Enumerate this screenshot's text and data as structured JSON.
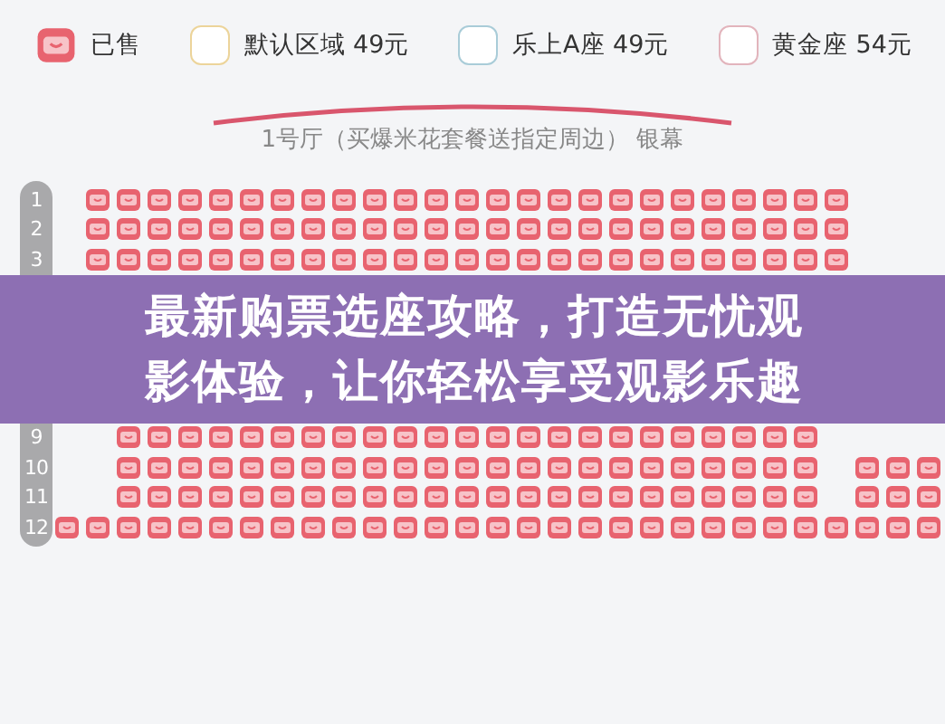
{
  "legend": [
    {
      "kind": "sold",
      "label": "已售"
    },
    {
      "kind": "default",
      "label": "默认区域 49元",
      "color": "#ecd49a"
    },
    {
      "kind": "zone",
      "label": "乐上A座 49元",
      "color": "#a9ccd8"
    },
    {
      "kind": "zone",
      "label": "黄金座 54元",
      "color": "#e2b4bc"
    }
  ],
  "screen": {
    "label": "1号厅（买爆米花套餐送指定周边） 银幕"
  },
  "rows_top": [
    {
      "number": "1",
      "seats": [
        {
          "kind": "gap"
        },
        {
          "kind": "seat",
          "sold": true
        },
        {
          "kind": "seat",
          "sold": true
        },
        {
          "kind": "seat",
          "sold": true
        },
        {
          "kind": "seat",
          "sold": true
        },
        {
          "kind": "seat",
          "sold": true
        },
        {
          "kind": "seat",
          "sold": true
        },
        {
          "kind": "seat",
          "sold": true
        },
        {
          "kind": "seat",
          "sold": true
        },
        {
          "kind": "seat",
          "sold": true
        },
        {
          "kind": "seat",
          "sold": true
        },
        {
          "kind": "seat",
          "sold": true
        },
        {
          "kind": "seat",
          "sold": true
        },
        {
          "kind": "seat",
          "sold": true
        },
        {
          "kind": "seat",
          "sold": true
        },
        {
          "kind": "seat",
          "sold": true
        },
        {
          "kind": "seat",
          "sold": true
        },
        {
          "kind": "seat",
          "sold": true
        },
        {
          "kind": "seat",
          "sold": true
        },
        {
          "kind": "seat",
          "sold": true
        },
        {
          "kind": "seat",
          "sold": true
        },
        {
          "kind": "seat",
          "sold": true
        },
        {
          "kind": "seat",
          "sold": true
        },
        {
          "kind": "seat",
          "sold": true
        },
        {
          "kind": "seat",
          "sold": true
        },
        {
          "kind": "seat",
          "sold": true
        }
      ]
    },
    {
      "number": "2",
      "seats": [
        {
          "kind": "gap"
        },
        {
          "kind": "seat",
          "sold": true
        },
        {
          "kind": "seat",
          "sold": true
        },
        {
          "kind": "seat",
          "sold": true
        },
        {
          "kind": "seat",
          "sold": true
        },
        {
          "kind": "seat",
          "sold": true
        },
        {
          "kind": "seat",
          "sold": true
        },
        {
          "kind": "seat",
          "sold": true
        },
        {
          "kind": "seat",
          "sold": true
        },
        {
          "kind": "seat",
          "sold": true
        },
        {
          "kind": "seat",
          "sold": true
        },
        {
          "kind": "seat",
          "sold": true
        },
        {
          "kind": "seat",
          "sold": true
        },
        {
          "kind": "seat",
          "sold": true
        },
        {
          "kind": "seat",
          "sold": true
        },
        {
          "kind": "seat",
          "sold": true
        },
        {
          "kind": "seat",
          "sold": true
        },
        {
          "kind": "seat",
          "sold": true
        },
        {
          "kind": "seat",
          "sold": true
        },
        {
          "kind": "seat",
          "sold": true
        },
        {
          "kind": "seat",
          "sold": true
        },
        {
          "kind": "seat",
          "sold": true
        },
        {
          "kind": "seat",
          "sold": true
        },
        {
          "kind": "seat",
          "sold": true
        },
        {
          "kind": "seat",
          "sold": true
        },
        {
          "kind": "seat",
          "sold": true
        }
      ]
    },
    {
      "number": "3",
      "seats": [
        {
          "kind": "gap"
        },
        {
          "kind": "seat",
          "sold": true
        },
        {
          "kind": "seat",
          "sold": true
        },
        {
          "kind": "seat",
          "sold": true
        },
        {
          "kind": "seat",
          "sold": true
        },
        {
          "kind": "seat",
          "sold": true
        },
        {
          "kind": "seat",
          "sold": true
        },
        {
          "kind": "seat",
          "sold": true
        },
        {
          "kind": "seat",
          "sold": true
        },
        {
          "kind": "seat",
          "sold": true
        },
        {
          "kind": "seat",
          "sold": true
        },
        {
          "kind": "seat",
          "sold": true
        },
        {
          "kind": "seat",
          "sold": true
        },
        {
          "kind": "seat",
          "sold": true
        },
        {
          "kind": "seat",
          "sold": true
        },
        {
          "kind": "seat",
          "sold": true
        },
        {
          "kind": "seat",
          "sold": true
        },
        {
          "kind": "seat",
          "sold": true
        },
        {
          "kind": "seat",
          "sold": true
        },
        {
          "kind": "seat",
          "sold": true
        },
        {
          "kind": "seat",
          "sold": true
        },
        {
          "kind": "seat",
          "sold": true
        },
        {
          "kind": "seat",
          "sold": true
        },
        {
          "kind": "seat",
          "sold": true
        },
        {
          "kind": "seat",
          "sold": true
        },
        {
          "kind": "seat",
          "sold": true
        }
      ]
    }
  ],
  "banner": {
    "title": "最新购票选座攻略，打造无忧观影体验，让你轻松享受观影乐趣"
  },
  "rows_bottom": [
    {
      "number": "9",
      "seats": [
        {
          "kind": "gap"
        },
        {
          "kind": "gap"
        },
        {
          "kind": "seat",
          "sold": true
        },
        {
          "kind": "seat",
          "sold": true
        },
        {
          "kind": "seat",
          "sold": true
        },
        {
          "kind": "seat",
          "sold": true
        },
        {
          "kind": "seat",
          "sold": true
        },
        {
          "kind": "seat",
          "sold": true
        },
        {
          "kind": "seat",
          "sold": true
        },
        {
          "kind": "seat",
          "sold": true
        },
        {
          "kind": "seat",
          "sold": true
        },
        {
          "kind": "seat",
          "sold": true
        },
        {
          "kind": "seat",
          "sold": true
        },
        {
          "kind": "seat",
          "sold": true
        },
        {
          "kind": "seat",
          "sold": true
        },
        {
          "kind": "seat",
          "sold": true
        },
        {
          "kind": "seat",
          "sold": true
        },
        {
          "kind": "seat",
          "sold": true
        },
        {
          "kind": "seat",
          "sold": true
        },
        {
          "kind": "seat",
          "sold": true
        },
        {
          "kind": "seat",
          "sold": true
        },
        {
          "kind": "seat",
          "sold": true
        },
        {
          "kind": "seat",
          "sold": true
        },
        {
          "kind": "seat",
          "sold": true
        },
        {
          "kind": "seat",
          "sold": true
        }
      ]
    },
    {
      "number": "10",
      "seats": [
        {
          "kind": "gap"
        },
        {
          "kind": "gap"
        },
        {
          "kind": "seat",
          "sold": true
        },
        {
          "kind": "seat",
          "sold": true
        },
        {
          "kind": "seat",
          "sold": true
        },
        {
          "kind": "seat",
          "sold": true
        },
        {
          "kind": "seat",
          "sold": true
        },
        {
          "kind": "seat",
          "sold": true
        },
        {
          "kind": "seat",
          "sold": true
        },
        {
          "kind": "seat",
          "sold": true
        },
        {
          "kind": "seat",
          "sold": true
        },
        {
          "kind": "seat",
          "sold": true
        },
        {
          "kind": "seat",
          "sold": true
        },
        {
          "kind": "seat",
          "sold": true
        },
        {
          "kind": "seat",
          "sold": true
        },
        {
          "kind": "seat",
          "sold": true
        },
        {
          "kind": "seat",
          "sold": true
        },
        {
          "kind": "seat",
          "sold": true
        },
        {
          "kind": "seat",
          "sold": true
        },
        {
          "kind": "seat",
          "sold": true
        },
        {
          "kind": "seat",
          "sold": true
        },
        {
          "kind": "seat",
          "sold": true
        },
        {
          "kind": "seat",
          "sold": true
        },
        {
          "kind": "seat",
          "sold": true
        },
        {
          "kind": "seat",
          "sold": true
        },
        {
          "kind": "gap"
        },
        {
          "kind": "seat",
          "sold": true
        },
        {
          "kind": "seat",
          "sold": true
        },
        {
          "kind": "seat",
          "sold": true
        }
      ]
    },
    {
      "number": "11",
      "seats": [
        {
          "kind": "gap"
        },
        {
          "kind": "gap"
        },
        {
          "kind": "seat",
          "sold": true
        },
        {
          "kind": "seat",
          "sold": true
        },
        {
          "kind": "seat",
          "sold": true
        },
        {
          "kind": "seat",
          "sold": true
        },
        {
          "kind": "seat",
          "sold": true
        },
        {
          "kind": "seat",
          "sold": true
        },
        {
          "kind": "seat",
          "sold": true
        },
        {
          "kind": "seat",
          "sold": true
        },
        {
          "kind": "seat",
          "sold": true
        },
        {
          "kind": "seat",
          "sold": true
        },
        {
          "kind": "seat",
          "sold": true
        },
        {
          "kind": "seat",
          "sold": true
        },
        {
          "kind": "seat",
          "sold": true
        },
        {
          "kind": "seat",
          "sold": true
        },
        {
          "kind": "seat",
          "sold": true
        },
        {
          "kind": "seat",
          "sold": true
        },
        {
          "kind": "seat",
          "sold": true
        },
        {
          "kind": "seat",
          "sold": true
        },
        {
          "kind": "seat",
          "sold": true
        },
        {
          "kind": "seat",
          "sold": true
        },
        {
          "kind": "seat",
          "sold": true
        },
        {
          "kind": "seat",
          "sold": true
        },
        {
          "kind": "seat",
          "sold": true
        },
        {
          "kind": "gap"
        },
        {
          "kind": "seat",
          "sold": true
        },
        {
          "kind": "seat",
          "sold": true
        },
        {
          "kind": "seat",
          "sold": true
        }
      ]
    },
    {
      "number": "12",
      "seats": [
        {
          "kind": "seat",
          "sold": true
        },
        {
          "kind": "seat",
          "sold": true
        },
        {
          "kind": "seat",
          "sold": true
        },
        {
          "kind": "seat",
          "sold": true
        },
        {
          "kind": "seat",
          "sold": true
        },
        {
          "kind": "seat",
          "sold": true
        },
        {
          "kind": "seat",
          "sold": true
        },
        {
          "kind": "seat",
          "sold": true
        },
        {
          "kind": "seat",
          "sold": true
        },
        {
          "kind": "seat",
          "sold": true
        },
        {
          "kind": "seat",
          "sold": true
        },
        {
          "kind": "seat",
          "sold": true
        },
        {
          "kind": "seat",
          "sold": true
        },
        {
          "kind": "seat",
          "sold": true
        },
        {
          "kind": "seat",
          "sold": true
        },
        {
          "kind": "seat",
          "sold": true
        },
        {
          "kind": "seat",
          "sold": true
        },
        {
          "kind": "seat",
          "sold": true
        },
        {
          "kind": "seat",
          "sold": true
        },
        {
          "kind": "seat",
          "sold": true
        },
        {
          "kind": "seat",
          "sold": true
        },
        {
          "kind": "seat",
          "sold": true
        },
        {
          "kind": "seat",
          "sold": true
        },
        {
          "kind": "seat",
          "sold": true
        },
        {
          "kind": "seat",
          "sold": true
        },
        {
          "kind": "seat",
          "sold": true
        },
        {
          "kind": "seat",
          "sold": true
        },
        {
          "kind": "seat",
          "sold": true
        },
        {
          "kind": "seat",
          "sold": true
        }
      ]
    }
  ]
}
